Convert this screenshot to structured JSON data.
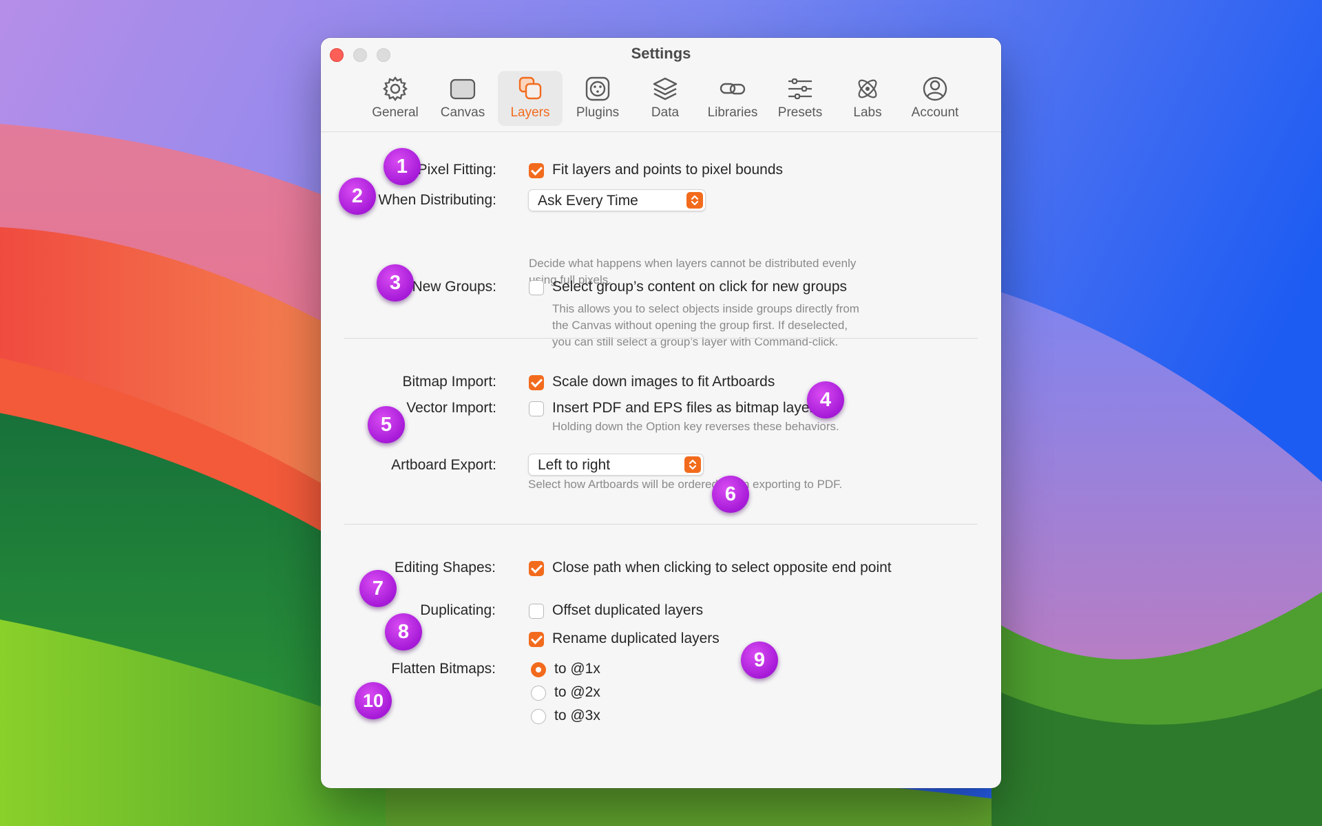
{
  "window": {
    "title": "Settings"
  },
  "toolbar": {
    "tabs": [
      {
        "label": "General",
        "icon": "gear-icon"
      },
      {
        "label": "Canvas",
        "icon": "canvas-icon"
      },
      {
        "label": "Layers",
        "icon": "layers-icon",
        "active": true
      },
      {
        "label": "Plugins",
        "icon": "plugin-icon"
      },
      {
        "label": "Data",
        "icon": "stack-icon"
      },
      {
        "label": "Libraries",
        "icon": "link-icon"
      },
      {
        "label": "Presets",
        "icon": "sliders-icon"
      },
      {
        "label": "Labs",
        "icon": "atom-icon"
      },
      {
        "label": "Account",
        "icon": "person-icon"
      }
    ]
  },
  "settings": {
    "pixel_fitting": {
      "label": "Pixel Fitting:",
      "option": "Fit layers and points to pixel bounds",
      "checked": true
    },
    "when_distributing": {
      "label": "When Distributing:",
      "value": "Ask Every Time",
      "help_line1": "Decide what happens when layers cannot be distributed evenly",
      "help_line2": "using full pixels."
    },
    "new_groups": {
      "label": "New Groups:",
      "option": "Select group’s content on click for new groups",
      "checked": false,
      "help_line1": "This allows you to select objects inside groups directly from",
      "help_line2": "the Canvas without opening the group first. If deselected,",
      "help_line3": "you can still select a group’s layer with Command-click."
    },
    "bitmap_import": {
      "label": "Bitmap Import:",
      "option": "Scale down images to fit Artboards",
      "checked": true
    },
    "vector_import": {
      "label": "Vector Import:",
      "option": "Insert PDF and EPS files as bitmap layers",
      "checked": false,
      "help": "Holding down the Option key reverses these behaviors."
    },
    "artboard_export": {
      "label": "Artboard Export:",
      "value": "Left to right",
      "help": "Select how Artboards will be ordered when exporting to PDF."
    },
    "editing_shapes": {
      "label": "Editing Shapes:",
      "option": "Close path when clicking to select opposite end point",
      "checked": true
    },
    "duplicating": {
      "label": "Duplicating:",
      "offset_option": "Offset duplicated layers",
      "offset_checked": false,
      "rename_option": "Rename duplicated layers",
      "rename_checked": true
    },
    "flatten_bitmaps": {
      "label": "Flatten Bitmaps:",
      "options": [
        "to @1x",
        "to @2x",
        "to @3x"
      ],
      "selected": "to @1x"
    }
  },
  "badges": [
    "1",
    "2",
    "3",
    "4",
    "5",
    "6",
    "7",
    "8",
    "9",
    "10"
  ],
  "colors": {
    "accent": "#f26b1d",
    "badge": "#b326e0"
  }
}
